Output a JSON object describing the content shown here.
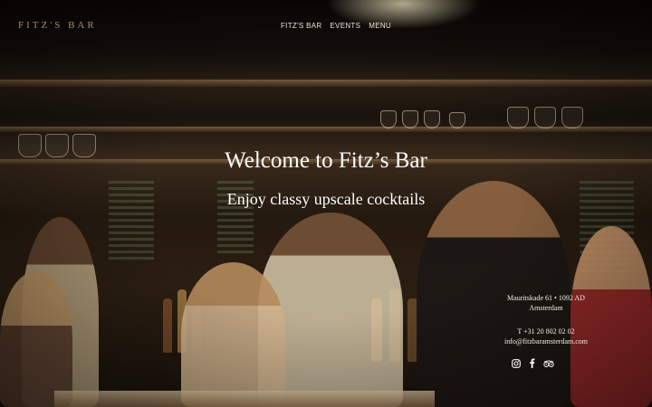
{
  "brand": {
    "logo_text": "FITZ'S BAR"
  },
  "nav": {
    "items": [
      "FITZ'S BAR",
      "EVENTS",
      "MENU"
    ]
  },
  "hero": {
    "title": "Welcome to Fitz’s Bar",
    "subtitle": "Enjoy classy upscale cocktails"
  },
  "contact": {
    "address_line1": "Mauritskade 61 • 1092 AD",
    "address_line2": "Amsterdam",
    "phone": "T +31 20 802 02 02",
    "email": "info@fitzbaramsterdam.com"
  },
  "social": [
    "instagram-icon",
    "facebook-icon",
    "tripadvisor-icon"
  ],
  "colors": {
    "logo": "#a88a63",
    "text": "#ffffff",
    "background": "#1a130d"
  }
}
